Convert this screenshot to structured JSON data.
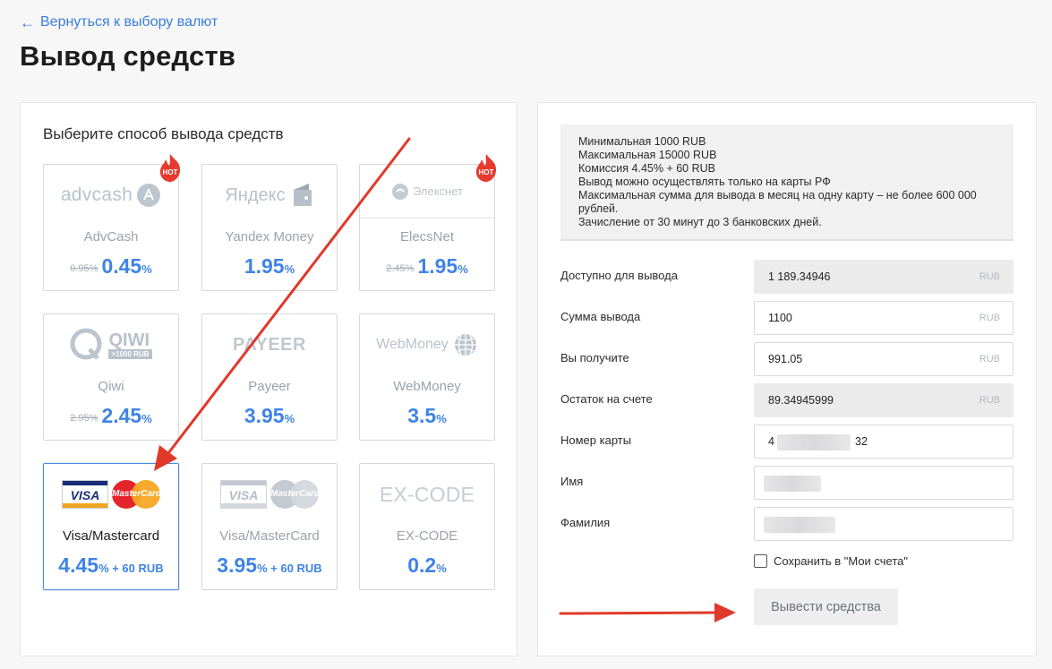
{
  "header": {
    "back_link": "Вернуться к выбору валют",
    "title": "Вывод средств"
  },
  "methods": {
    "heading": "Выберите способ вывода средств",
    "hot_badge": "HOT",
    "items": [
      {
        "name": "AdvCash",
        "old_fee": "0.95%",
        "fee": "0.45",
        "fee_suffix": "%",
        "logo_text": "advcash",
        "hot": true
      },
      {
        "name": "Yandex Money",
        "old_fee": "",
        "fee": "1.95",
        "fee_suffix": "%",
        "logo_text": "Яндекс",
        "hot": false
      },
      {
        "name": "ElecsNet",
        "old_fee": "2.45%",
        "fee": "1.95",
        "fee_suffix": "%",
        "logo_text": "Элекснет",
        "hot": true
      },
      {
        "name": "Qiwi",
        "old_fee": "2.95%",
        "fee": "2.45",
        "fee_suffix": "%",
        "logo_text": "QIWI",
        "logo_sub": ">1000 RUB",
        "hot": false
      },
      {
        "name": "Payeer",
        "old_fee": "",
        "fee": "3.95",
        "fee_suffix": "%",
        "logo_text": "PAYEER",
        "hot": false
      },
      {
        "name": "WebMoney",
        "old_fee": "",
        "fee": "3.5",
        "fee_suffix": "%",
        "logo_text": "WebMoney",
        "hot": false
      },
      {
        "name": "Visa/Mastercard",
        "old_fee": "",
        "fee": "4.45",
        "fee_suffix": "% + 60 RUB",
        "logo_text": "VISA",
        "logo_text2": "MasterCard",
        "hot": false,
        "selected": true
      },
      {
        "name": "Visa/MasterCard",
        "old_fee": "",
        "fee": "3.95",
        "fee_suffix": "% + 60 RUB",
        "logo_text": "VISA",
        "logo_text2": "MasterCard",
        "hot": false
      },
      {
        "name": "EX-CODE",
        "old_fee": "",
        "fee": "0.2",
        "fee_suffix": "%",
        "logo_text": "EX-CODE",
        "hot": false
      }
    ]
  },
  "info": {
    "lines": [
      "Минимальная 1000 RUB",
      "Максимальная 15000 RUB",
      "Комиссия 4.45% + 60 RUB",
      "Вывод можно осуществлять только на карты РФ",
      "Максимальная сумма для вывода в месяц на одну карту – не более 600 000",
      "рублей.",
      "Зачисление от 30 минут до 3 банковских дней."
    ]
  },
  "form": {
    "available": {
      "label": "Доступно для вывода",
      "value": "1 189.34946",
      "unit": "RUB"
    },
    "amount": {
      "label": "Сумма вывода",
      "value": "1100",
      "unit": "RUB"
    },
    "receive": {
      "label": "Вы получите",
      "value": "991.05",
      "unit": "RUB"
    },
    "remainder": {
      "label": "Остаток на счете",
      "value": "89.34945999",
      "unit": "RUB"
    },
    "card": {
      "label": "Номер карты",
      "prefix": "4",
      "suffix": "32"
    },
    "first_name": {
      "label": "Имя"
    },
    "last_name": {
      "label": "Фамилия"
    },
    "save_label": "Сохранить в \"Мои счета\"",
    "submit_label": "Вывести средства"
  },
  "colors": {
    "accent": "#3f84e5",
    "annotation_arrow": "#e0392b",
    "hot_badge": "#e63a2e"
  }
}
